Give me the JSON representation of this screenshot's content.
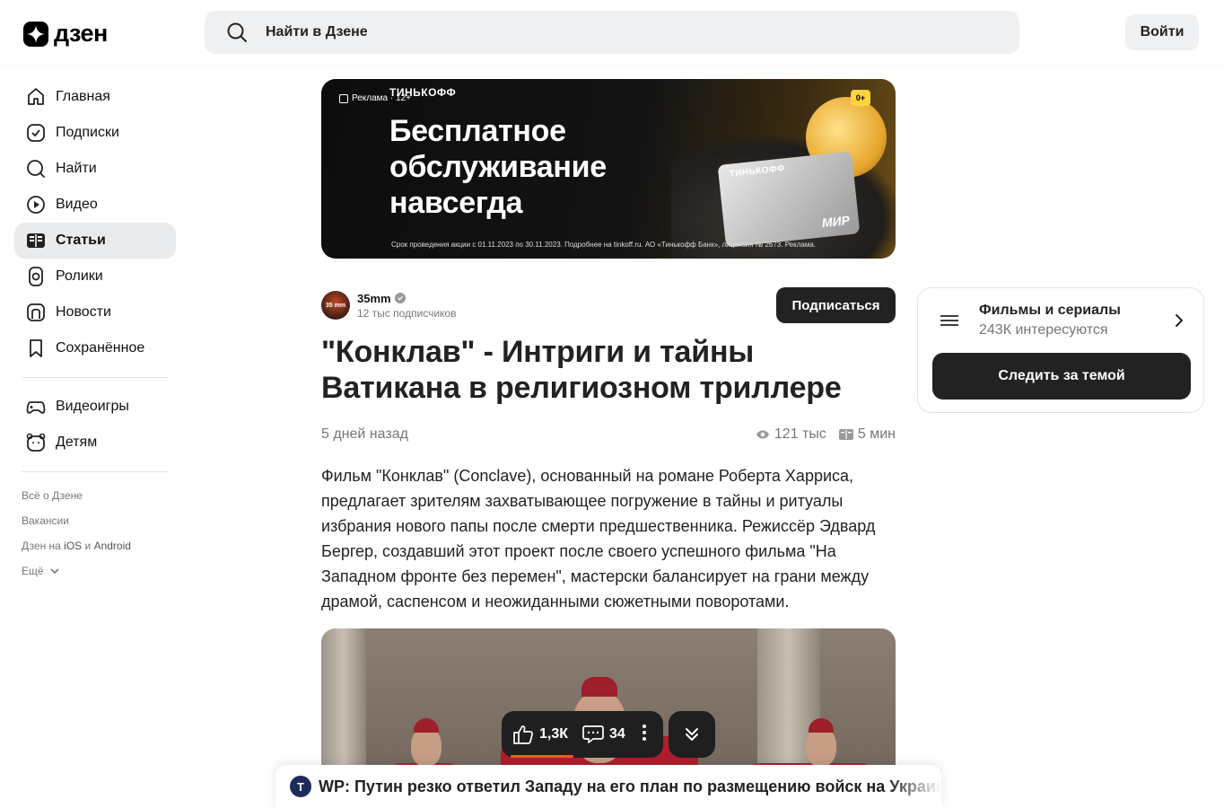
{
  "header": {
    "logo_text": "дзен",
    "search_placeholder": "Найти в Дзене",
    "login_label": "Войти"
  },
  "sidebar": {
    "items": [
      {
        "label": "Главная",
        "icon": "home-icon"
      },
      {
        "label": "Подписки",
        "icon": "subscriptions-icon"
      },
      {
        "label": "Найти",
        "icon": "search-icon"
      },
      {
        "label": "Видео",
        "icon": "video-icon"
      },
      {
        "label": "Статьи",
        "icon": "articles-icon",
        "active": true
      },
      {
        "label": "Ролики",
        "icon": "shorts-icon"
      },
      {
        "label": "Новости",
        "icon": "news-icon"
      },
      {
        "label": "Сохранённое",
        "icon": "bookmark-icon"
      }
    ],
    "items2": [
      {
        "label": "Видеоигры",
        "icon": "gamepad-icon"
      },
      {
        "label": "Детям",
        "icon": "kids-icon"
      }
    ],
    "footer": {
      "about": "Всё о Дзене",
      "jobs": "Вакансии",
      "apps_prefix": "Дзен на ",
      "ios": "iOS",
      "and": " и ",
      "android": "Android",
      "more": "Ещё"
    }
  },
  "ad": {
    "label": "Реклама · 12+",
    "brand": "ТИНЬКОФФ",
    "age": "0+",
    "headline": "Бесплатное обслуживание навсегда",
    "card_brand": "ТИНЬКОФФ",
    "card_mir": "МИР",
    "legal": "Срок проведения акции с 01.11.2023 по 30.11.2023. Подробнее на tinkoff.ru. АО «Тинькофф Банк», лицензия № 2673. Реклама."
  },
  "article": {
    "author": {
      "avatar_text": "35 mm",
      "name": "35mm",
      "subscribers": "12 тыс подписчиков",
      "subscribe_label": "Подписаться"
    },
    "title": "\"Конклав\" - Интриги и тайны Ватикана в религиозном триллере",
    "date": "5 дней назад",
    "views": "121 тыс",
    "read_time": "5 мин",
    "body": "Фильм \"Конклав\" (Conclave), основанный на романе Роберта Харриса, предлагает зрителям захватывающее погружение в тайны и ритуалы избрания нового папы после смерти предшественника. Режиссёр Эдвард Бергер, создавший этот проект после своего успешного фильма \"На Западном фронте без перемен\", мастерски балансирует на грани между драмой, саспенсом и неожиданными сюжетными поворотами."
  },
  "actions": {
    "likes": "1,3К",
    "comments": "34"
  },
  "news": {
    "source_letter": "Т",
    "text": "WP: Путин резко ответил Западу на его план по размещению войск на Украине"
  },
  "topic": {
    "title": "Фильмы и сериалы",
    "count": "243К интересуются",
    "follow_label": "Следить за темой"
  },
  "colors": {
    "accent_dark": "#222222",
    "like_progress": "#f25b23",
    "active_nav_bg": "#eaebed"
  }
}
